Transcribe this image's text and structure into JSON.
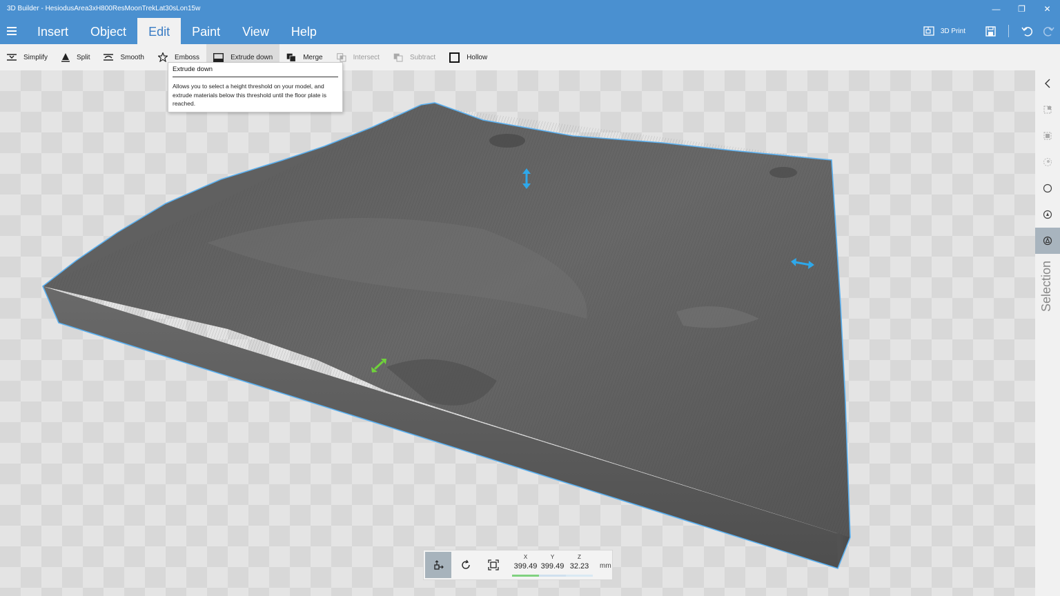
{
  "window": {
    "title": "3D Builder - HesiodusArea3xH800ResMoonTrekLat30sLon15w",
    "controls": [
      "—",
      "❐",
      "✕"
    ]
  },
  "menu": {
    "tabs": [
      {
        "label": "Insert"
      },
      {
        "label": "Object"
      },
      {
        "label": "Edit"
      },
      {
        "label": "Paint"
      },
      {
        "label": "View"
      },
      {
        "label": "Help"
      }
    ],
    "active_tab": "Edit",
    "print_label": "3D Print"
  },
  "toolbar": {
    "items": [
      {
        "label": "Simplify",
        "icon": "simplify-icon"
      },
      {
        "label": "Split",
        "icon": "split-icon"
      },
      {
        "label": "Smooth",
        "icon": "smooth-icon"
      },
      {
        "label": "Emboss",
        "icon": "star-icon"
      },
      {
        "label": "Extrude down",
        "icon": "extrude-down-icon"
      },
      {
        "label": "Merge",
        "icon": "merge-icon"
      },
      {
        "label": "Intersect",
        "icon": "intersect-icon"
      },
      {
        "label": "Subtract",
        "icon": "subtract-icon"
      },
      {
        "label": "Hollow",
        "icon": "hollow-icon"
      }
    ]
  },
  "tooltip": {
    "title": "Extrude down",
    "body": "Allows you to select a height threshold on your model, and extrude materials below this threshold until the floor plate is reached."
  },
  "side_panel": {
    "label": "Selection"
  },
  "transform": {
    "x_label": "X",
    "y_label": "Y",
    "z_label": "Z",
    "x": "399.49",
    "y": "399.49",
    "z": "32.23",
    "unit": "mm"
  },
  "colors": {
    "accent": "#4a90d0",
    "selection_outline": "#5ab0f0",
    "axis_x": "#7fd17f",
    "axis_y": "#cfe0ee",
    "axis_z": "#d9e9f3",
    "handle_blue": "#2ea8ea",
    "handle_green": "#6fd33a"
  }
}
